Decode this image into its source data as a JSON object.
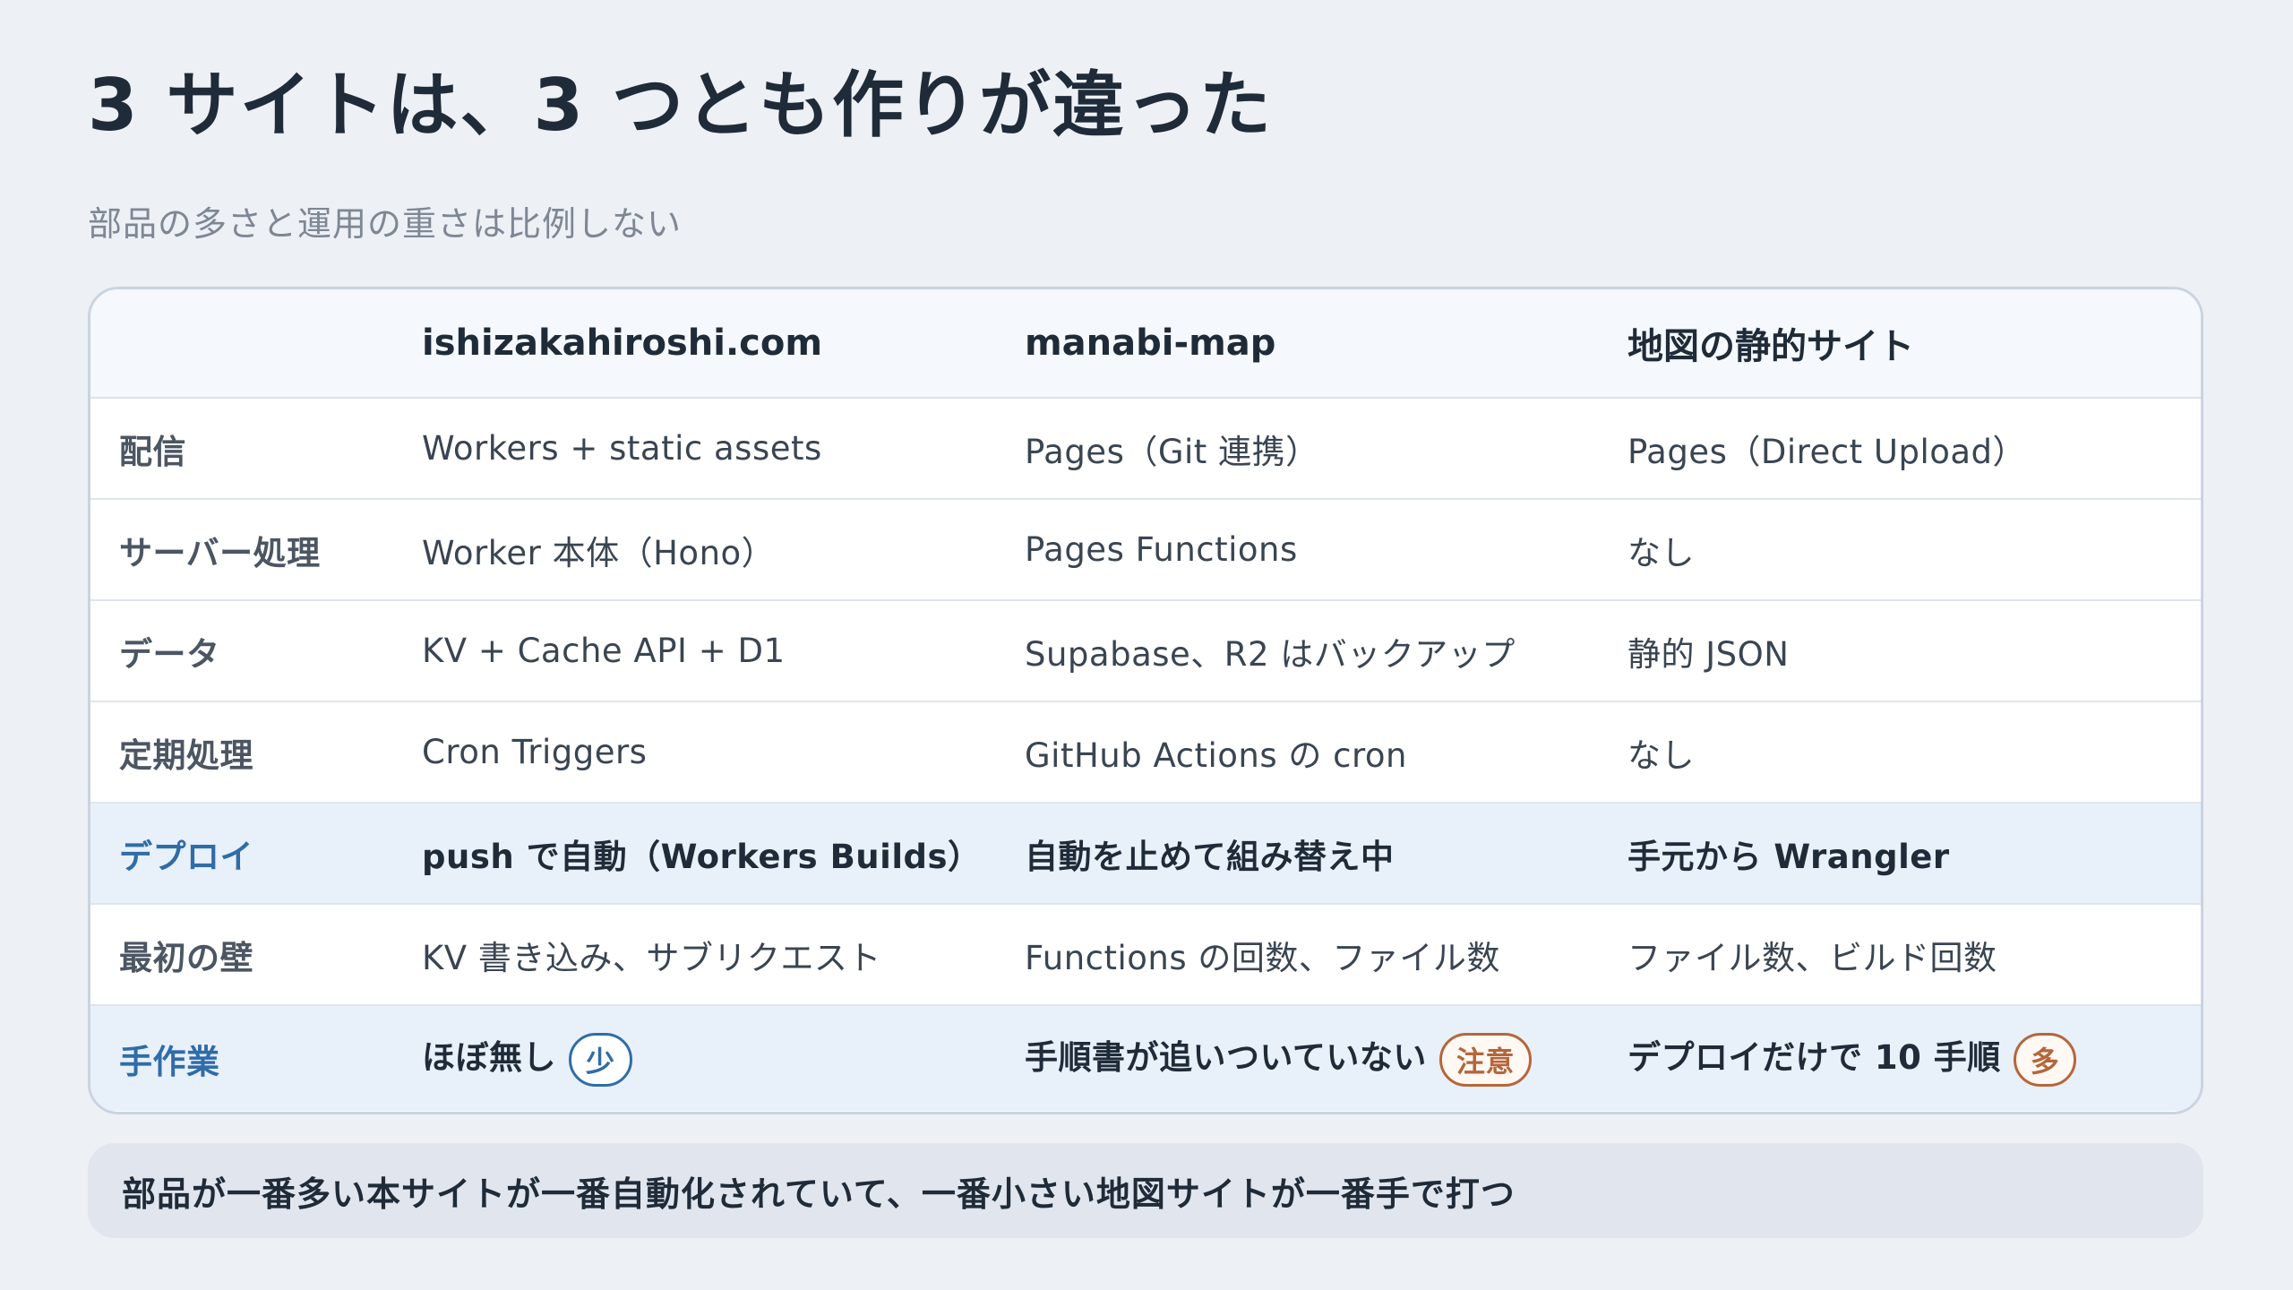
{
  "title": "3 サイトは、3 つとも作りが違った",
  "subtitle": "部品の多さと運用の重さは比例しない",
  "table": {
    "headers": [
      "",
      "ishizakahiroshi.com",
      "manabi-map",
      "地図の静的サイト"
    ],
    "rows": [
      {
        "label": "配信",
        "cells": [
          "Workers + static assets",
          "Pages（Git 連携）",
          "Pages（Direct Upload）"
        ]
      },
      {
        "label": "サーバー処理",
        "cells": [
          "Worker 本体（Hono）",
          "Pages Functions",
          "なし"
        ]
      },
      {
        "label": "データ",
        "cells": [
          "KV + Cache API + D1",
          "Supabase、R2 はバックアップ",
          "静的 JSON"
        ]
      },
      {
        "label": "定期処理",
        "cells": [
          "Cron Triggers",
          "GitHub Actions の cron",
          "なし"
        ]
      },
      {
        "label": "デプロイ",
        "cells": [
          "push で自動（Workers Builds）",
          "自動を止めて組み替え中",
          "手元から Wrangler"
        ]
      },
      {
        "label": "最初の壁",
        "cells": [
          "KV 書き込み、サブリクエスト",
          "Functions の回数、ファイル数",
          "ファイル数、ビルド回数"
        ]
      },
      {
        "label": "手作業",
        "cells": [
          "ほぼ無し",
          "手順書が追いついていない",
          "デプロイだけで 10 手順"
        ],
        "badges": [
          "少",
          "注意",
          "多"
        ]
      }
    ]
  },
  "footer_note": "部品が一番多い本サイトが一番自動化されていて、一番小さい地図サイトが一番手で打つ",
  "colors": {
    "background": "#edf0f5",
    "accent_blue": "#2f6ca8",
    "accent_orange": "#b5663a",
    "highlight_row": "#e8f0fa"
  }
}
